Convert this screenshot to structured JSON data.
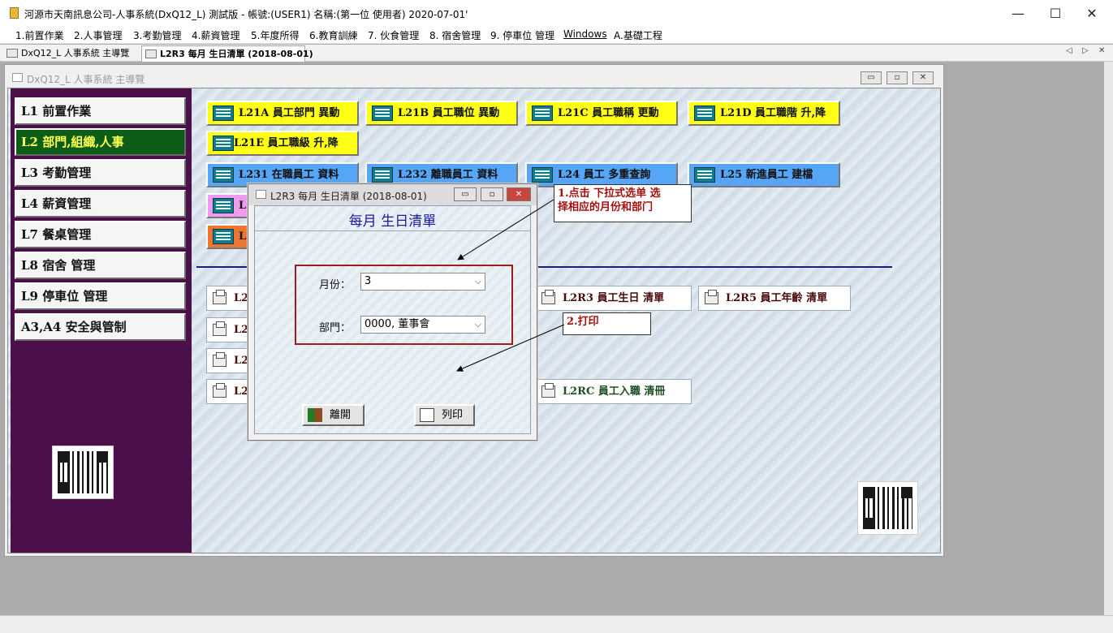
{
  "window": {
    "title": "河源市天南訊息公司-人事系統(DxQ12_L) 測試版 - 帳號:(USER1) 名稱:(第一位 使用者) 2020-07-01'",
    "minimize": "—",
    "maximize": "☐",
    "close": "✕"
  },
  "menu": [
    "1.前置作業",
    "2.人事管理",
    "3.考勤管理",
    "4.薪資管理",
    "5.年度所得",
    "6.教育訓練",
    "7. 伙食管理",
    "8. 宿舍管理",
    "9. 停車位 管理",
    "Windows",
    "A.基礎工程"
  ],
  "tabs": [
    {
      "label": "DxQ12_L 人事系統 主導覽"
    },
    {
      "label": "L2R3 每月 生日清單 (2018-08-01)"
    }
  ],
  "tab_nav": {
    "left": "◁",
    "right": "▷",
    "close": "✕"
  },
  "mdi": {
    "title": "DxQ12_L 人事系統 主導覽",
    "buttons": [
      "▭",
      "▫",
      "✕"
    ]
  },
  "sidebar": [
    {
      "label": "L1 前置作業"
    },
    {
      "label": "L2 部門,組織,人事",
      "active": true
    },
    {
      "label": "L3 考勤管理"
    },
    {
      "label": "L4 薪資管理"
    },
    {
      "label": "L7 餐桌管理"
    },
    {
      "label": "L8 宿舍 管理"
    },
    {
      "label": "L9 停車位 管理"
    },
    {
      "label": "A3,A4 安全與管制"
    }
  ],
  "modules": {
    "l21a": "L21A 員工部門 異動",
    "l21b": "L21B 員工職位 異動",
    "l21c": "L21C 員工職稱 更動",
    "l21d": "L21D 員工職階 升,降",
    "l21e": "L21E 員工職級 升,降",
    "l231": "L231 在職員工 資料",
    "l232": "L232 離職員工 資料",
    "l24": "L24   員工 多重查詢",
    "l25": "L25   新進員工 建檔",
    "pink": "L2",
    "orange": "L2"
  },
  "reports": {
    "r1": "L2",
    "r2": "L2",
    "r3": "L2",
    "r4": "L2",
    "l2r3": "L2R3 員工生日 清單",
    "l2r5": "L2R5 員工年齡 清單",
    "l2rc": "L2RC 員工入職 清冊"
  },
  "dialog": {
    "title": "L2R3 每月 生日清單 (2018-08-01)",
    "heading": "每月 生日清單",
    "month_label": "月份：",
    "month_value": "3",
    "dept_label": "部門：",
    "dept_value": "0000,  董事會",
    "exit_label": "離開",
    "print_label": "列印",
    "buttons": [
      "▭",
      "▫",
      "✕"
    ]
  },
  "annotations": {
    "note1_line1": "1.点击  下拉式选单  选",
    "note1_line2": "择相应的月份和部门",
    "note2": "2.打印"
  },
  "colors": {
    "sidebar_bg": "#4b0f49",
    "active_nav": "#0b5d17",
    "annotation_red": "#a30f0f",
    "heading_blue": "#1a1aa0"
  }
}
